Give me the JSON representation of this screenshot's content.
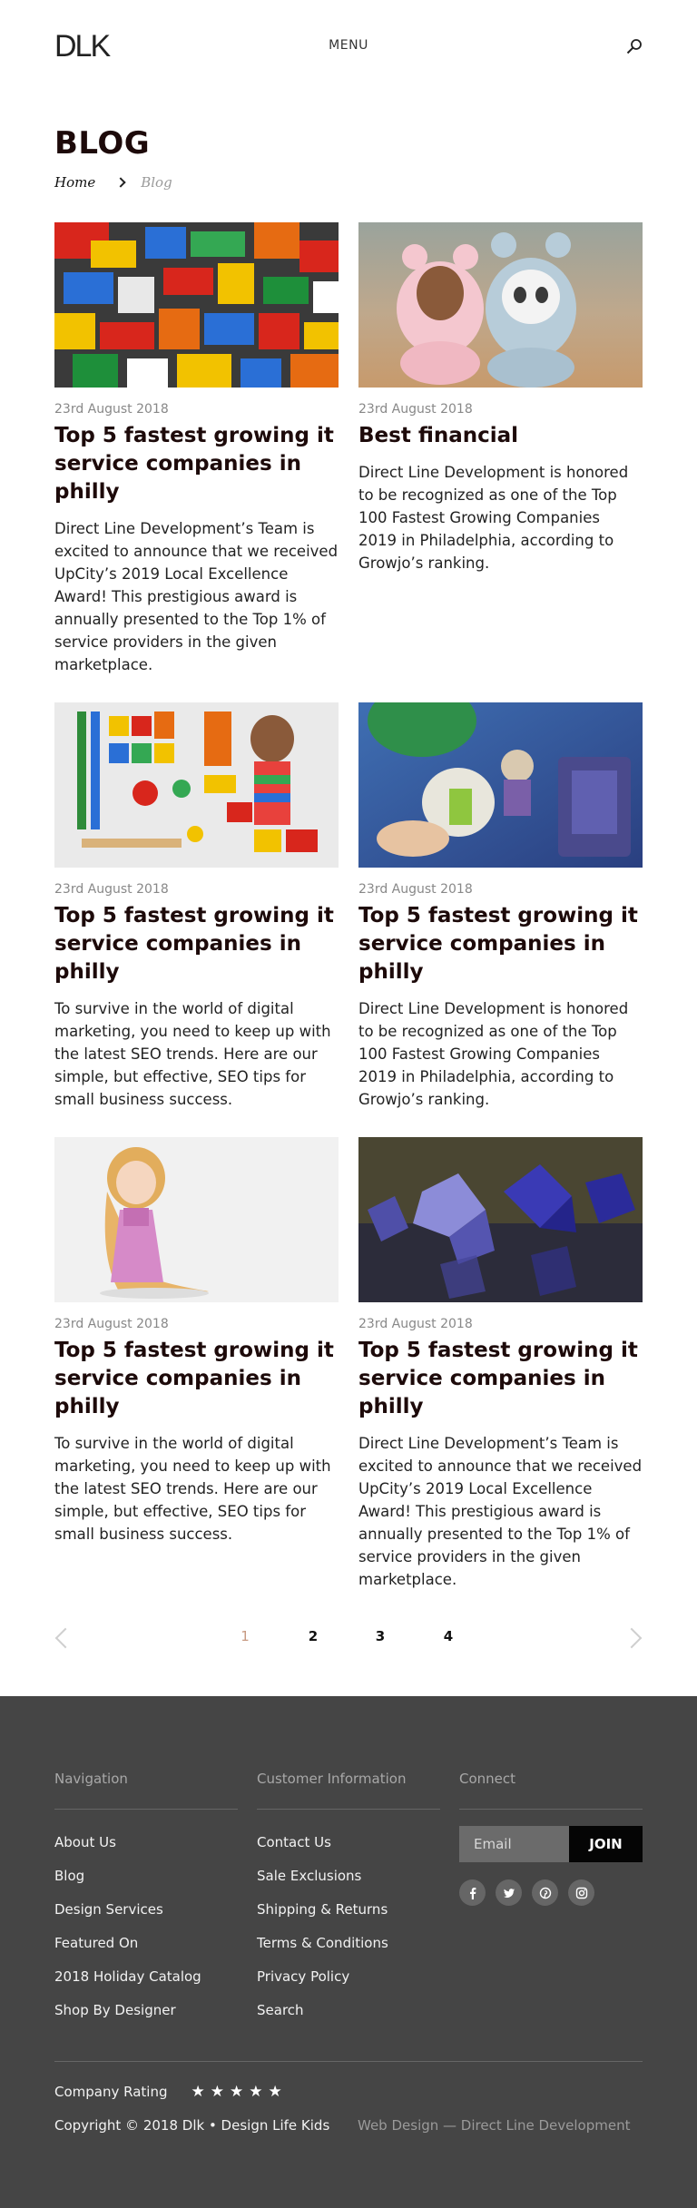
{
  "header": {
    "logo": "DLK",
    "menu_label": "MENU",
    "search_icon": "search-icon"
  },
  "page": {
    "title": "BLOG",
    "breadcrumb": {
      "home": "Home",
      "current": "Blog"
    }
  },
  "posts": [
    {
      "image": "lego-bricks-photo",
      "date": "23rd August 2018",
      "title": "Top 5 fastest growing it service companies in philly",
      "excerpt": "Direct Line Development’s Team is excited to announce that we received UpCity’s 2019 Local Excellence Award! This prestigious award is annually presented to the Top 1% of service providers in the given marketplace."
    },
    {
      "image": "toy-bears-photo",
      "date": "23rd August 2018",
      "title": "Best financial",
      "excerpt": "Direct Line Development is honored to be recognized as one of the Top 100 Fastest Growing Companies 2019 in Philadelphia, according to Growjo’s ranking."
    },
    {
      "image": "sorted-toys-photo",
      "date": "23rd August 2018",
      "title": "Top 5 fastest growing it service companies in philly",
      "excerpt": "To survive in the world of digital marketing, you need to keep up with the latest SEO trends. Here are our simple, but effective, SEO tips for small business success."
    },
    {
      "image": "buzz-lightyear-photo",
      "date": "23rd August 2018",
      "title": "Top 5 fastest growing it service companies in philly",
      "excerpt": "Direct Line Development is honored to be recognized as one of the Top 100 Fastest Growing Companies 2019 in Philadelphia, according to Growjo’s ranking."
    },
    {
      "image": "rapunzel-figure-photo",
      "date": "23rd August 2018",
      "title": "Top 5 fastest growing it service companies in philly",
      "excerpt": "To survive in the world of digital marketing, you need to keep up with the latest SEO trends. Here are our simple, but effective, SEO tips for small business success."
    },
    {
      "image": "dice-photo",
      "date": "23rd August 2018",
      "title": "Top 5 fastest growing it service companies in philly",
      "excerpt": "Direct Line Development’s Team is excited to announce that we received UpCity’s 2019 Local Excellence Award! This prestigious award is annually presented to the Top 1% of service providers in the given marketplace."
    }
  ],
  "pagination": {
    "pages": [
      "1",
      "2",
      "3",
      "4"
    ],
    "active_page": "1",
    "prev_icon": "chevron-left-icon",
    "next_icon": "chevron-right-icon"
  },
  "footer": {
    "navigation": {
      "heading": "Navigation",
      "links": [
        "About Us",
        "Blog",
        "Design Services",
        "Featured On",
        "2018 Holiday Catalog",
        "Shop By Designer"
      ]
    },
    "customer_info": {
      "heading": "Customer Information",
      "links": [
        "Contact Us",
        "Sale Exclusions",
        "Shipping & Returns",
        "Terms & Conditions",
        "Privacy Policy",
        "Search"
      ]
    },
    "connect": {
      "heading": "Connect",
      "email_placeholder": "Email",
      "join_label": "JOIN",
      "socials": [
        "facebook-icon",
        "twitter-icon",
        "pinterest-icon",
        "instagram-icon"
      ]
    },
    "rating_label": "Company Rating",
    "rating_stars": "★★★★★",
    "rating_value": 5,
    "copyright": "Copyright © 2018 Dlk • Design Life Kids",
    "credit": "Web Design — Direct Line Development"
  },
  "colors": {
    "title": "#1d0a0a",
    "active_page": "#c89a82",
    "footer_bg": "#454545"
  }
}
